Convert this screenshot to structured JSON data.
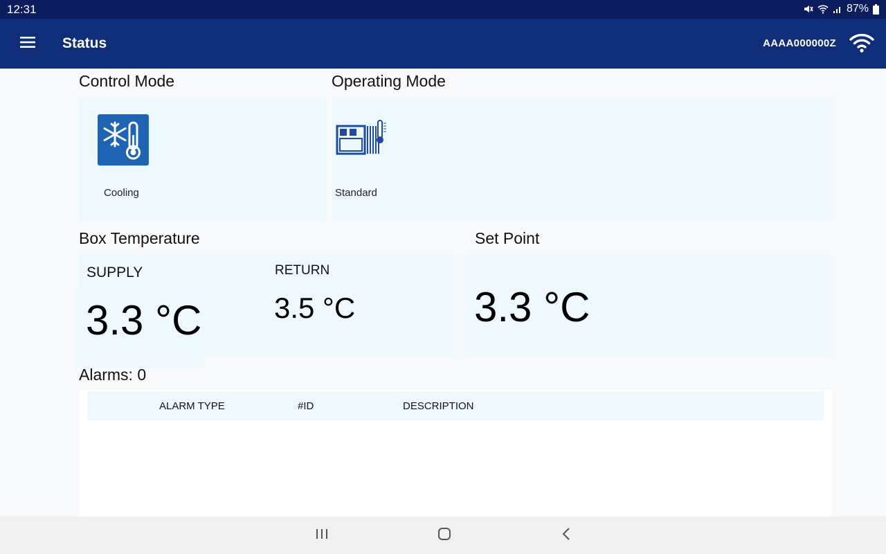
{
  "status_bar": {
    "time": "12:31",
    "battery": "87%"
  },
  "app_bar": {
    "title": "Status",
    "device_id": "AAAA000000Z"
  },
  "control_mode": {
    "title": "Control Mode",
    "label": "Cooling"
  },
  "operating_mode": {
    "title": "Operating Mode",
    "label": "Standard"
  },
  "box_temperature": {
    "title": "Box Temperature",
    "supply_label": "SUPPLY",
    "supply_value": "3.3 °C",
    "return_label": "RETURN",
    "return_value": "3.5 °C"
  },
  "set_point": {
    "title": "Set Point",
    "value": "3.3 °C"
  },
  "alarms": {
    "title": "Alarms: 0",
    "columns": [
      "ALARM TYPE",
      "#ID",
      "DESCRIPTION"
    ],
    "rows": []
  },
  "colors": {
    "status_bar": "#0b1d5e",
    "app_bar": "#0f2d78",
    "panel": "#eef9fd",
    "icon_blue": "#1f63b3"
  },
  "icons": [
    "menu-icon",
    "wifi-icon",
    "snowflake-thermometer-icon",
    "container-unit-icon",
    "recents-icon",
    "home-icon",
    "back-icon"
  ]
}
